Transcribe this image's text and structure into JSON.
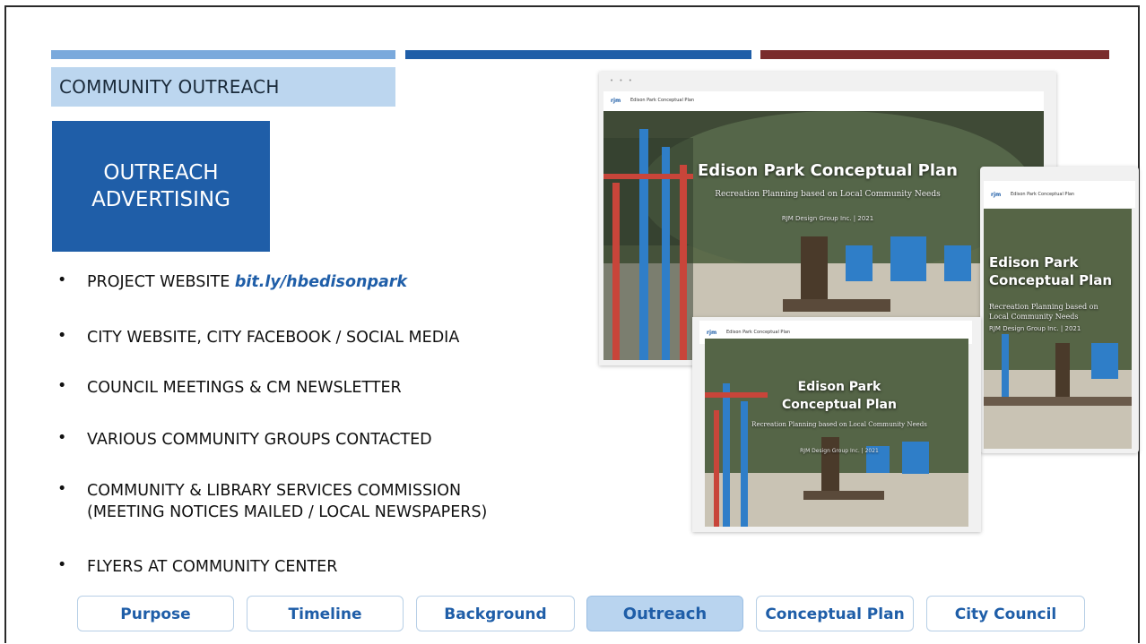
{
  "section_label": "COMMUNITY OUTREACH",
  "subtitle": {
    "line1": "OUTREACH",
    "line2": "ADVERTISING"
  },
  "bullets": [
    {
      "text": "PROJECT WEBSITE",
      "link": "bit.ly/hbedisonpark"
    },
    {
      "text": "CITY WEBSITE, CITY FACEBOOK / SOCIAL MEDIA"
    },
    {
      "text": "COUNCIL MEETINGS & CM NEWSLETTER"
    },
    {
      "text": "VARIOUS COMMUNITY GROUPS CONTACTED"
    },
    {
      "text": "COMMUNITY & LIBRARY SERVICES COMMISSION",
      "text2": "(MEETING NOTICES MAILED / LOCAL NEWSPAPERS)"
    },
    {
      "text": "FLYERS AT COMMUNITY CENTER"
    }
  ],
  "bullet_symbol": "•",
  "nav": [
    {
      "label": "Purpose",
      "active": false
    },
    {
      "label": "Timeline",
      "active": false
    },
    {
      "label": "Background",
      "active": false
    },
    {
      "label": "Outreach",
      "active": true
    },
    {
      "label": "Conceptual Plan",
      "active": false
    },
    {
      "label": "City Council",
      "active": false
    }
  ],
  "mockup": {
    "site_name": "Edison Park Conceptual Plan",
    "logo": "rjm",
    "hero_title": "Edison Park Conceptual Plan",
    "hero_title_line1": "Edison Park",
    "hero_title_line2": "Conceptual Plan",
    "hero_subtitle": "Recreation Planning based on Local Community Needs",
    "hero_sub_line1": "Recreation Planning based on",
    "hero_sub_line2": "Local Community Needs",
    "hero_org": "RJM Design Group Inc. | 2021",
    "window_dots": "• • •"
  },
  "colors": {
    "light_blue": "#7aa9dc",
    "blue": "#1f5ea8",
    "maroon": "#7a2b2b",
    "pale_blue": "#bcd6ef"
  }
}
